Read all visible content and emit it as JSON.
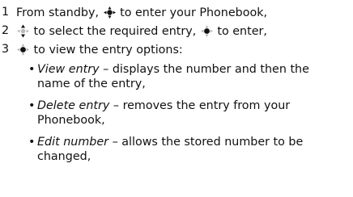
{
  "steps": [
    {
      "number": "1",
      "before": "From standby, ",
      "after": " to enter your Phonebook,",
      "icon": "navigation-key-press-icon"
    },
    {
      "number": "2",
      "before": "",
      "after": " to select the required entry, ",
      "icon": "navigation-key-up-down-icon",
      "middle_icon": "navigation-key-press-icon",
      "end": " to enter,"
    },
    {
      "number": "3",
      "before": "",
      "after": " to view the entry options:",
      "icon": "navigation-key-press-icon"
    }
  ],
  "options": [
    {
      "term": "View entry",
      "line1": " – displays the number and then the",
      "line2": "name of the entry,"
    },
    {
      "term": "Delete entry",
      "line1": " – removes the entry from your",
      "line2": "Phonebook,"
    },
    {
      "term": "Edit number",
      "line1": " – allows the stored number to be",
      "line2": "changed,"
    }
  ],
  "bullet": "•"
}
